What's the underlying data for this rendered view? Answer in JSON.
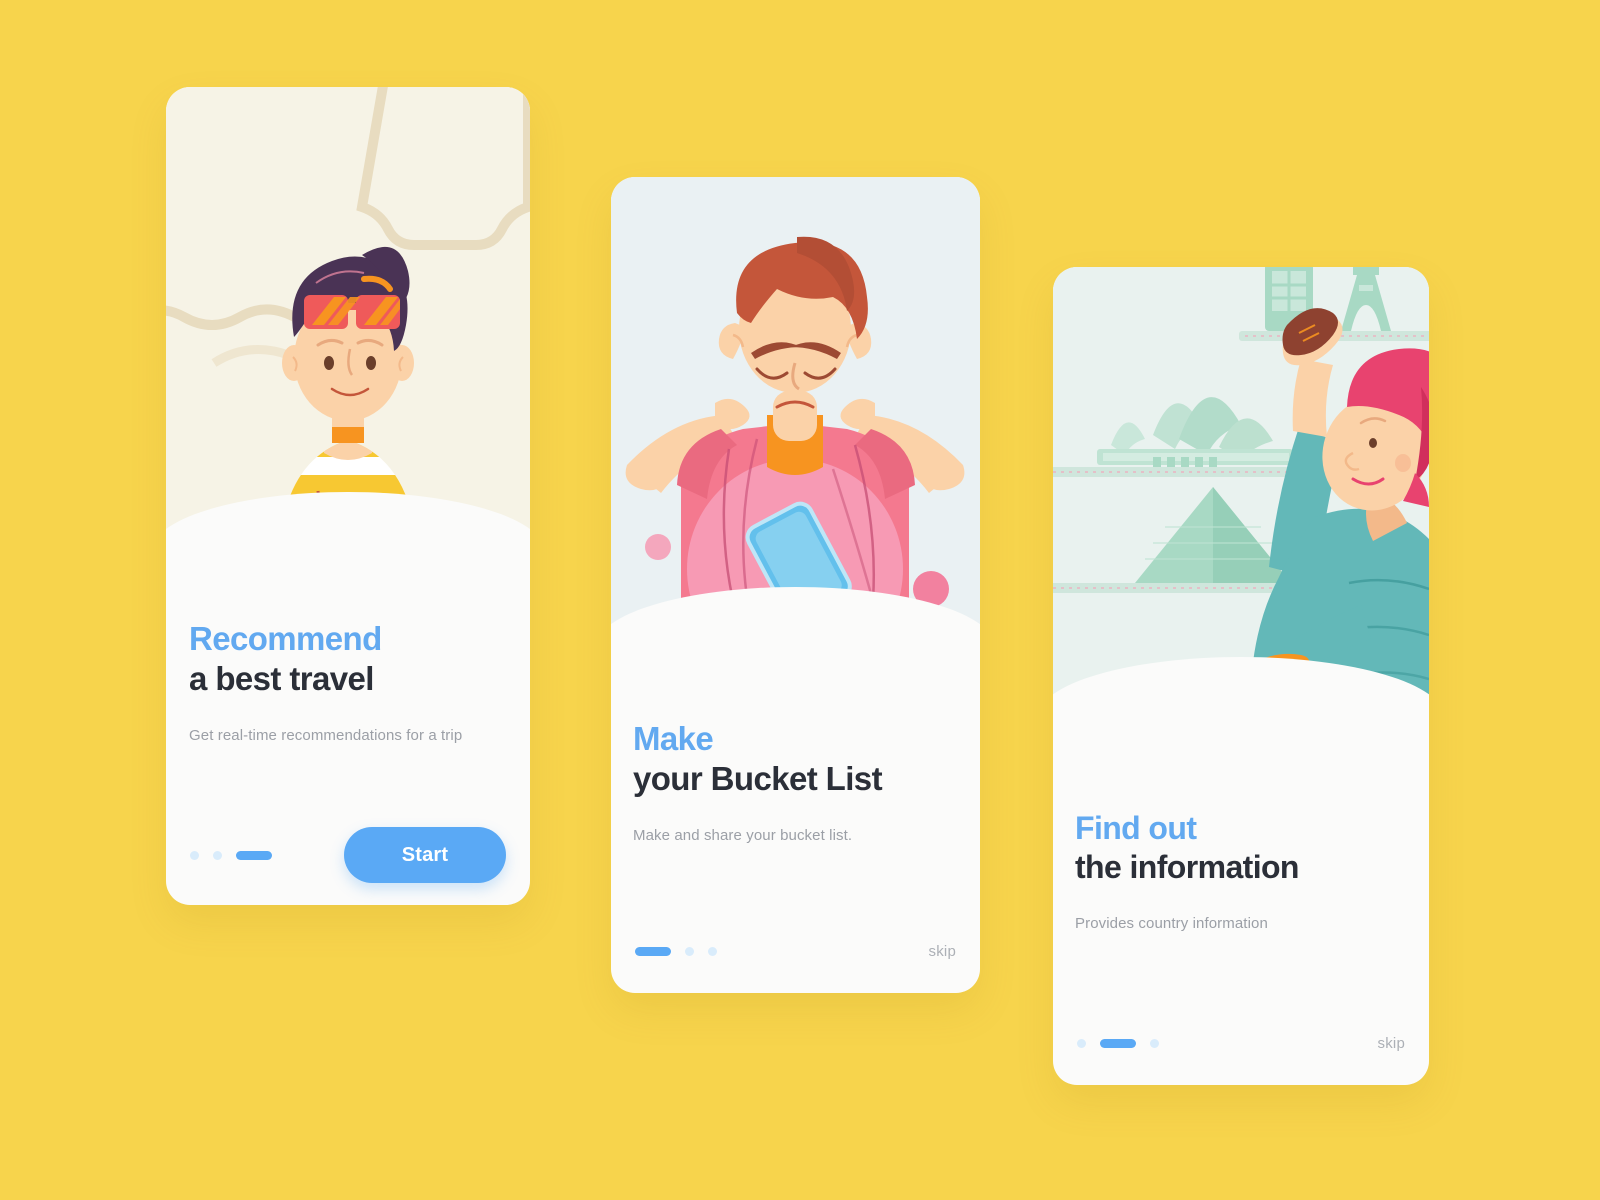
{
  "background_color": "#f7d44c",
  "theme": {
    "accent_blue": "#5aa9f5",
    "title_dark": "#2b2f38",
    "subtitle_gray": "#9b9fa6",
    "dot_inactive": "#d9ecfb",
    "card_white": "#fbfbfa"
  },
  "cards": [
    {
      "id": "recommend",
      "illustration_name": "woman-with-sunglasses-and-laptop",
      "illustration_bg": "#f6f3e6",
      "title_line1": "Recommend",
      "title_line2": "a best travel",
      "subtitle": "Get real-time recommendations for a trip",
      "pagination": {
        "count": 3,
        "active_index": 2
      },
      "action": {
        "type": "button",
        "label": "Start"
      }
    },
    {
      "id": "bucket-list",
      "illustration_name": "man-covering-ears-with-phone-in-shirt",
      "illustration_bg": "#eaf1f3",
      "title_line1": "Make",
      "title_line2": "your Bucket List",
      "subtitle": "Make and share your bucket list.",
      "pagination": {
        "count": 3,
        "active_index": 0
      },
      "action": {
        "type": "link",
        "label": "skip"
      }
    },
    {
      "id": "find-information",
      "illustration_name": "woman-reaching-for-landmark-souvenirs-on-shelf",
      "illustration_bg": "#e9f2ef",
      "title_line1": "Find out",
      "title_line2": "the information",
      "subtitle": "Provides country information",
      "pagination": {
        "count": 3,
        "active_index": 1
      },
      "action": {
        "type": "link",
        "label": "skip"
      }
    }
  ],
  "illustration_colors": {
    "skin": "#fbd2a8",
    "skin_shadow": "#f3b98a",
    "hair_purple": "#4a3355",
    "hair_auburn": "#c4563a",
    "hair_pink": "#e8436f",
    "sunglasses_red": "#ef5a5a",
    "sunglasses_orange": "#f79420",
    "shirt_yellow": "#f7c832",
    "shirt_pink": "#f4798f",
    "shirt_pink_light": "#f79ab4",
    "shirt_teal": "#63b8b8",
    "phone_blue": "#63c0ec",
    "landmark_mint": "#a8d9c4",
    "frame_beige": "#e8dcc0"
  }
}
